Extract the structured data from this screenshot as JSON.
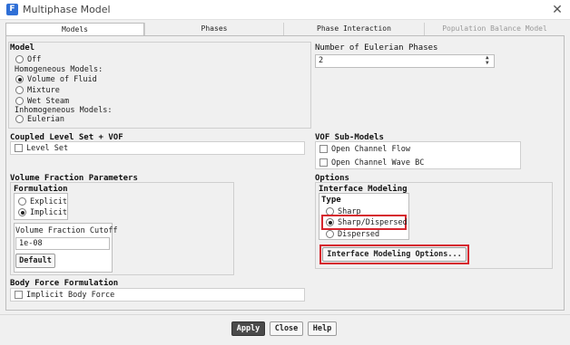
{
  "window": {
    "title": "Multiphase Model",
    "app_icon_letter": "F",
    "close_glyph": "✕"
  },
  "tabs": [
    {
      "label": "Models",
      "active": true
    },
    {
      "label": "Phases",
      "active": false
    },
    {
      "label": "Phase Interaction",
      "active": false
    },
    {
      "label": "Population Balance Model",
      "active": false,
      "disabled": true
    }
  ],
  "model": {
    "title": "Model",
    "off": "Off",
    "homogeneous_heading": "Homogeneous Models:",
    "vof": "Volume of Fluid",
    "mixture": "Mixture",
    "wet_steam": "Wet Steam",
    "inhomogeneous_heading": "Inhomogeneous Models:",
    "eulerian": "Eulerian",
    "selected": "Volume of Fluid"
  },
  "eulerian_phases": {
    "title": "Number of Eulerian Phases",
    "value": "2"
  },
  "coupled_level_set": {
    "title": "Coupled Level Set + VOF",
    "level_set": "Level Set",
    "level_set_checked": false
  },
  "vof_sub_models": {
    "title": "VOF Sub-Models",
    "open_channel_flow": "Open Channel Flow",
    "open_channel_wave_bc": "Open Channel Wave BC"
  },
  "volume_fraction": {
    "title": "Volume Fraction Parameters",
    "formulation_title": "Formulation",
    "explicit": "Explicit",
    "implicit": "Implicit",
    "selected": "Implicit",
    "cutoff_title": "Volume Fraction Cutoff",
    "cutoff_value": "1e-08",
    "default_button": "Default"
  },
  "options": {
    "title": "Options",
    "interface_modeling_title": "Interface Modeling",
    "type_title": "Type",
    "sharp": "Sharp",
    "sharp_dispersed": "Sharp/Dispersed",
    "dispersed": "Dispersed",
    "selected": "Sharp/Dispersed",
    "interface_options_button": "Interface Modeling Options..."
  },
  "body_force": {
    "title": "Body Force Formulation",
    "implicit_body_force": "Implicit Body Force"
  },
  "footer": {
    "apply": "Apply",
    "close": "Close",
    "help": "Help"
  },
  "colors": {
    "highlight": "#d6262e",
    "accent": "#2f6fd6"
  }
}
